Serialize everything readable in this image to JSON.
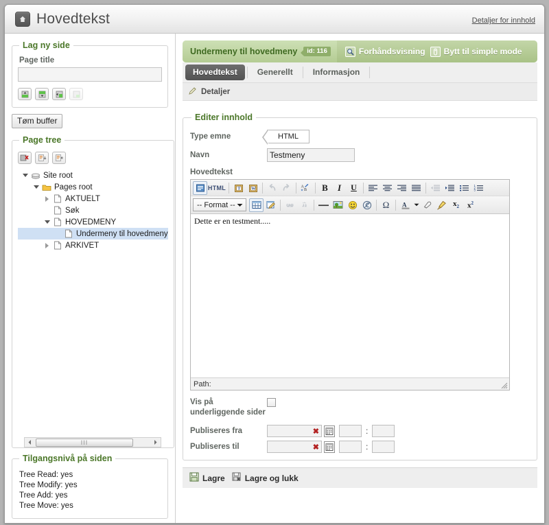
{
  "window": {
    "title": "Hovedtekst",
    "home_icon": "home-icon",
    "details_link": "Detaljer for innhold"
  },
  "sidebar": {
    "new_page": {
      "legend": "Lag ny side",
      "page_title_label": "Page title",
      "page_title_value": "",
      "page_title_placeholder": "",
      "buttons": [
        {
          "name": "add-page-above-button",
          "icon": "page-up-icon",
          "disabled": false
        },
        {
          "name": "add-page-below-button",
          "icon": "page-down-icon",
          "disabled": false
        },
        {
          "name": "add-page-sibling-button",
          "icon": "page-right-icon",
          "disabled": false
        },
        {
          "name": "add-page-child-button",
          "icon": "page-child-icon",
          "disabled": true
        }
      ]
    },
    "clear_buffer_button": "Tøm buffer",
    "page_tree": {
      "legend": "Page tree",
      "toolbar": [
        {
          "name": "delete-node-button",
          "icon": "delete-page-icon",
          "disabled": false
        },
        {
          "name": "cut-node-button",
          "icon": "cut-page-icon",
          "disabled": false
        },
        {
          "name": "paste-node-button",
          "icon": "paste-page-icon",
          "disabled": false
        }
      ],
      "nodes": [
        {
          "label": "Site root",
          "depth": 0,
          "icon": "site-root-icon",
          "twist": "expanded",
          "selected": false
        },
        {
          "label": "Pages root",
          "depth": 1,
          "icon": "folder-icon",
          "twist": "expanded",
          "selected": false
        },
        {
          "label": "AKTUELT",
          "depth": 2,
          "icon": "page-icon",
          "twist": "collapsed",
          "selected": false
        },
        {
          "label": "Søk",
          "depth": 2,
          "icon": "page-icon",
          "twist": "none",
          "selected": false
        },
        {
          "label": "HOVEDMENY",
          "depth": 2,
          "icon": "page-icon",
          "twist": "expanded",
          "selected": false
        },
        {
          "label": "Undermeny til hovedmeny",
          "depth": 3,
          "icon": "page-icon",
          "twist": "none",
          "selected": true
        },
        {
          "label": "ARKIVET",
          "depth": 2,
          "icon": "page-icon",
          "twist": "collapsed",
          "selected": false
        }
      ],
      "scrollbar": {
        "left_arrow": "◄",
        "right_arrow": "►",
        "thumb_grip": "III"
      }
    },
    "access": {
      "legend": "Tilgangsnivå på siden",
      "lines": [
        "Tree Read: yes",
        "Tree Modify: yes",
        "Tree Add: yes",
        "Tree Move: yes"
      ]
    }
  },
  "content": {
    "green_header": {
      "title": "Undermeny til hovedmeny",
      "id_badge": "id: 116",
      "preview_label": "Forhåndsvisning",
      "preview_icon": "preview-magnifier-icon",
      "simple_mode_label": "Bytt til simple mode",
      "simple_mode_icon": "toggle-icon"
    },
    "tabs": [
      {
        "label": "Hovedtekst",
        "active": true
      },
      {
        "label": "Generellt",
        "active": false
      },
      {
        "label": "Informasjon",
        "active": false
      }
    ],
    "subbar": {
      "label": "Detaljer",
      "icon": "edit-pencil-icon"
    },
    "editor_panel": {
      "legend": "Editer innhold",
      "type_label": "Type emne",
      "type_value": "HTML",
      "name_label": "Navn",
      "name_value": "Testmeny",
      "name_placeholder": "",
      "body_label": "Hovedtekst",
      "body_text": "Dette er en testment.....",
      "path_label": "Path:",
      "format_select": "-- Format --",
      "toolbar_row1": [
        {
          "name": "source-button",
          "icon": "source-view-icon",
          "kind": "icon",
          "framed": true,
          "disabled": false
        },
        {
          "name": "html-button",
          "icon": "html-label-icon",
          "kind": "text",
          "text": "HTML",
          "disabled": false
        },
        {
          "name": "sep",
          "kind": "sep"
        },
        {
          "name": "paste-text-button",
          "icon": "paste-text-icon",
          "kind": "icon",
          "disabled": false
        },
        {
          "name": "paste-word-button",
          "icon": "paste-word-icon",
          "kind": "icon",
          "disabled": false
        },
        {
          "name": "sep",
          "kind": "sep"
        },
        {
          "name": "undo-button",
          "icon": "undo-arrow-icon",
          "kind": "icon",
          "disabled": true
        },
        {
          "name": "redo-button",
          "icon": "redo-arrow-icon",
          "kind": "icon",
          "disabled": true
        },
        {
          "name": "sep",
          "kind": "sep"
        },
        {
          "name": "spellcheck-button",
          "icon": "spellcheck-abc-icon",
          "kind": "icon",
          "disabled": false
        },
        {
          "name": "sep",
          "kind": "sep"
        },
        {
          "name": "bold-button",
          "icon": "bold-icon",
          "kind": "icon",
          "disabled": false
        },
        {
          "name": "italic-button",
          "icon": "italic-icon",
          "kind": "icon",
          "disabled": false
        },
        {
          "name": "underline-button",
          "icon": "underline-icon",
          "kind": "icon",
          "disabled": false
        },
        {
          "name": "sep",
          "kind": "sep"
        },
        {
          "name": "align-left-button",
          "icon": "align-left-icon",
          "kind": "icon",
          "disabled": false
        },
        {
          "name": "align-center-button",
          "icon": "align-center-icon",
          "kind": "icon",
          "disabled": false
        },
        {
          "name": "align-right-button",
          "icon": "align-right-icon",
          "kind": "icon",
          "disabled": false
        },
        {
          "name": "align-justify-button",
          "icon": "align-justify-icon",
          "kind": "icon",
          "disabled": false
        },
        {
          "name": "sep",
          "kind": "sep"
        },
        {
          "name": "outdent-button",
          "icon": "outdent-icon",
          "kind": "icon",
          "disabled": true
        },
        {
          "name": "indent-button",
          "icon": "indent-icon",
          "kind": "icon",
          "disabled": false
        },
        {
          "name": "bullet-list-button",
          "icon": "bullet-list-icon",
          "kind": "icon",
          "disabled": false
        },
        {
          "name": "numbered-list-button",
          "icon": "numbered-list-icon",
          "kind": "icon",
          "disabled": false
        }
      ],
      "toolbar_row2": [
        {
          "name": "table-button",
          "icon": "table-icon",
          "kind": "icon",
          "framed": true,
          "disabled": false
        },
        {
          "name": "table-properties-button",
          "icon": "table-edit-icon",
          "kind": "icon",
          "disabled": false
        },
        {
          "name": "sep",
          "kind": "sep"
        },
        {
          "name": "link-button",
          "icon": "link-chain-icon",
          "kind": "icon",
          "disabled": true
        },
        {
          "name": "unlink-button",
          "icon": "unlink-broken-chain-icon",
          "kind": "icon",
          "disabled": true
        },
        {
          "name": "sep",
          "kind": "sep"
        },
        {
          "name": "horizontal-rule-button",
          "icon": "horizontal-rule-icon",
          "kind": "icon",
          "disabled": false
        },
        {
          "name": "image-button",
          "icon": "image-tree-icon",
          "kind": "icon",
          "disabled": false
        },
        {
          "name": "smiley-button",
          "icon": "smiley-face-icon",
          "kind": "icon",
          "disabled": false
        },
        {
          "name": "flash-button",
          "icon": "flash-icon",
          "kind": "icon",
          "disabled": false
        },
        {
          "name": "sep",
          "kind": "sep"
        },
        {
          "name": "special-char-button",
          "icon": "omega-icon",
          "kind": "icon",
          "disabled": false
        },
        {
          "name": "sep",
          "kind": "sep"
        },
        {
          "name": "text-color-button",
          "icon": "text-color-a-icon",
          "kind": "icon",
          "disabled": false
        },
        {
          "name": "text-color-dropdown",
          "icon": "chevron-down-icon",
          "kind": "icon",
          "disabled": false
        },
        {
          "name": "remove-format-button",
          "icon": "eraser-icon",
          "kind": "icon",
          "disabled": false
        },
        {
          "name": "format-painter-button",
          "icon": "brush-icon",
          "kind": "icon",
          "disabled": false
        },
        {
          "name": "subscript-button",
          "icon": "subscript-icon",
          "kind": "icon",
          "disabled": false
        },
        {
          "name": "superscript-button",
          "icon": "superscript-icon",
          "kind": "icon",
          "disabled": false
        }
      ]
    },
    "options": {
      "show_on_sub_label": "Vis på underliggende sider",
      "show_on_sub_checked": false,
      "publish_from_label": "Publiseres fra",
      "publish_from_date": "",
      "publish_from_hour": "",
      "publish_from_minute": "",
      "publish_to_label": "Publiseres til",
      "publish_to_date": "",
      "publish_to_hour": "",
      "publish_to_minute": "",
      "time_separator": ":",
      "clear_icon": "✖",
      "calendar_icon": "calendar-icon"
    },
    "actions": [
      {
        "label": "Lagre",
        "icon": "save-disk-icon",
        "name": "save-button"
      },
      {
        "label": "Lagre og lukk",
        "icon": "save-close-disk-icon",
        "name": "save-and-close-button"
      }
    ]
  },
  "colors": {
    "green_accent": "#4b7729",
    "green_header_light": "#cde0b5",
    "green_header_dark": "#a9c286",
    "tab_active": "#5c5c5c",
    "tree_selected": "#cfe0f4",
    "label_gray": "#5f6560"
  }
}
